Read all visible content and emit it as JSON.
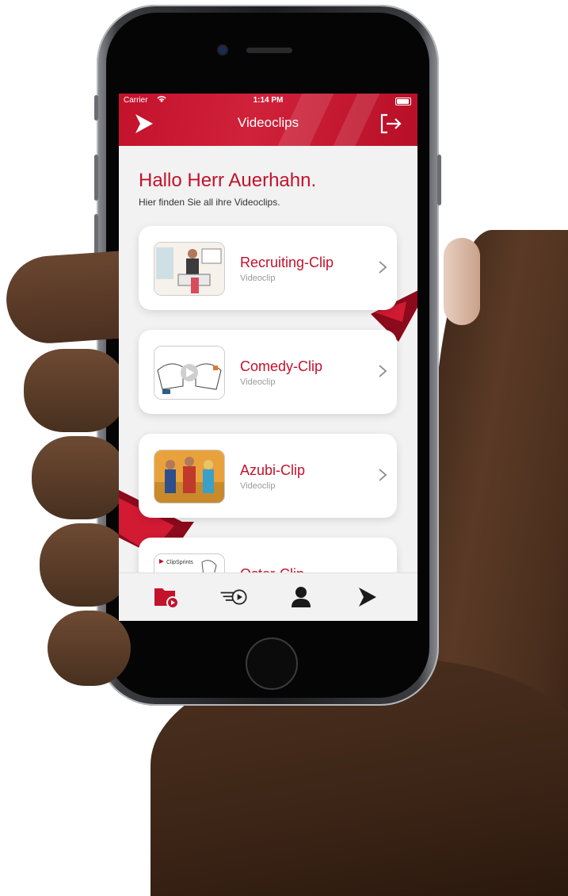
{
  "status_bar": {
    "carrier": "Carrier",
    "time": "1:14 PM"
  },
  "nav": {
    "title": "Videoclips"
  },
  "greeting": {
    "title": "Hallo Herr Auerhahn.",
    "subtitle": "Hier finden Sie all ihre Videoclips."
  },
  "clips": [
    {
      "title": "Recruiting-Clip",
      "type": "Videoclip"
    },
    {
      "title": "Comedy-Clip",
      "type": "Videoclip"
    },
    {
      "title": "Azubi-Clip",
      "type": "Videoclip"
    },
    {
      "title": "Oster-Clip",
      "type": "",
      "thumb_label": "ClipSprints"
    }
  ],
  "tabs": [
    {
      "icon": "folder-video-icon",
      "active": true
    },
    {
      "icon": "play-list-icon",
      "active": false
    },
    {
      "icon": "person-icon",
      "active": false
    },
    {
      "icon": "brand-play-icon",
      "active": false
    }
  ],
  "colors": {
    "brand_red": "#c3122c",
    "background": "#f2f2f2",
    "subtitle_gray": "#9a9a9a"
  }
}
